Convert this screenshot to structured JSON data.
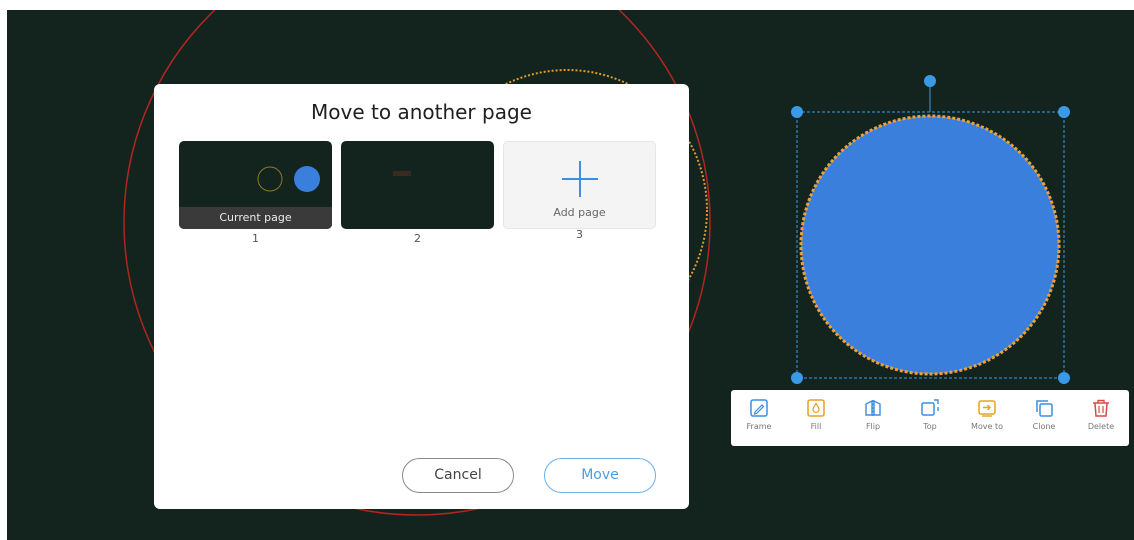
{
  "dialog": {
    "title": "Move to another page",
    "pages": [
      {
        "number": "1",
        "label": "Current page"
      },
      {
        "number": "2",
        "label": ""
      },
      {
        "number": "3",
        "label": "Add page"
      }
    ],
    "cancel_label": "Cancel",
    "move_label": "Move"
  },
  "toolbar": {
    "items": [
      {
        "label": "Frame",
        "icon": "frame-icon"
      },
      {
        "label": "Fill",
        "icon": "fill-icon"
      },
      {
        "label": "Flip",
        "icon": "flip-icon"
      },
      {
        "label": "Top",
        "icon": "bring-to-top-icon"
      },
      {
        "label": "Move to",
        "icon": "move-to-icon"
      },
      {
        "label": "Clone",
        "icon": "clone-icon"
      },
      {
        "label": "Delete",
        "icon": "delete-icon"
      }
    ]
  },
  "colors": {
    "canvas_bg": "#13241f",
    "shape_fill": "#3a7fdc",
    "selection": "#3a9ae8",
    "shape_outline": "#f0a033",
    "accent": "#4a9ee3"
  }
}
